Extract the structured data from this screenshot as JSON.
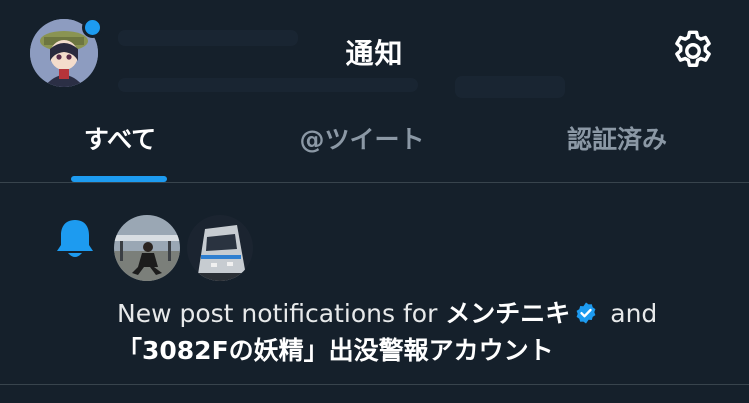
{
  "header": {
    "title": "通知",
    "avatar_dot_color": "#1d9bf0"
  },
  "tabs": [
    {
      "label": "すべて",
      "active": true
    },
    {
      "label": "@ツイート",
      "active": false
    },
    {
      "label": "認証済み",
      "active": false
    }
  ],
  "notification": {
    "icon": "bell-icon",
    "text_prefix": "New post notifications for ",
    "account_1": "メンチニキ",
    "account_1_verified": true,
    "conjunction": " and",
    "account_2": "「3082Fの妖精」出没警報アカウント"
  },
  "colors": {
    "background": "#15202b",
    "accent": "#1d9bf0",
    "divider": "#38444d",
    "muted_text": "#8b98a5"
  }
}
